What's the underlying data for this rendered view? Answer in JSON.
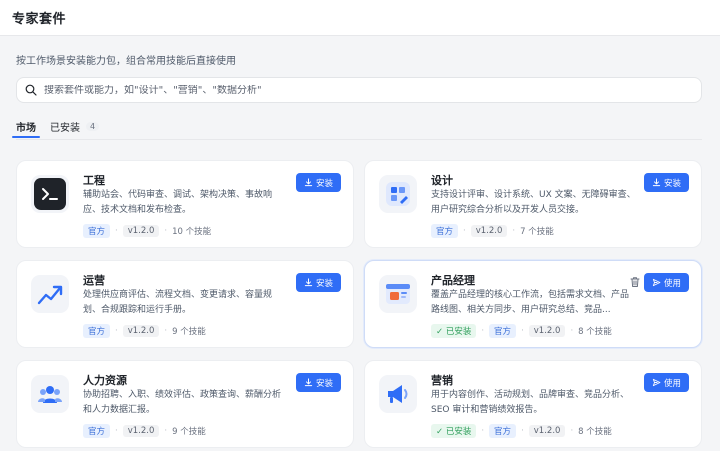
{
  "header": {
    "title": "专家套件"
  },
  "description": "按工作场景安装能力包，组合常用技能后直接使用",
  "search": {
    "placeholder": "搜索套件或能力，如\"设计\"、\"营销\"、\"数据分析\"",
    "value": ""
  },
  "tabs": [
    {
      "label": "市场",
      "active": true
    },
    {
      "label": "已安装",
      "count": "4"
    }
  ],
  "cards": [
    {
      "title": "工程",
      "desc": "辅助站会、代码审查、调试、架构决策、事故响应、技术文档和发布检查。",
      "official": "官方",
      "version": "v1.2.0",
      "skills": "10 个技能",
      "button": "安装",
      "icon": "terminal-icon",
      "color": "#1f2329"
    },
    {
      "title": "设计",
      "desc": "支持设计评审、设计系统、UX 文案、无障碍审查、用户研究综合分析以及开发人员交接。",
      "official": "官方",
      "version": "v1.2.0",
      "skills": "7 个技能",
      "button": "安装",
      "icon": "design-palette-icon",
      "color": "#2f6df6"
    },
    {
      "title": "运营",
      "desc": "处理供应商评估、流程文档、变更请求、容量规划、合规跟踪和运行手册。",
      "official": "官方",
      "version": "v1.2.0",
      "skills": "9 个技能",
      "button": "安装",
      "icon": "trend-chart-icon",
      "color": "#2f6df6"
    },
    {
      "title": "产品经理",
      "desc": "覆盖产品经理的核心工作流，包括需求文档、产品路线图、相关方同步、用户研究总结、竞品...",
      "installed": "已安装",
      "official": "官方",
      "version": "v1.2.0",
      "skills": "8 个技能",
      "button": "使用",
      "icon": "product-window-icon",
      "color": "#f06b3c"
    },
    {
      "title": "人力资源",
      "desc": "协助招聘、入职、绩效评估、政策查询、薪酬分析和人力数据汇报。",
      "official": "官方",
      "version": "v1.2.0",
      "skills": "9 个技能",
      "button": "安装",
      "icon": "people-group-icon",
      "color": "#2f6df6"
    },
    {
      "title": "营销",
      "desc": "用于内容创作、活动规划、品牌审查、竞品分析、SEO 审计和营销绩效报告。",
      "installed": "已安装",
      "official": "官方",
      "version": "v1.2.0",
      "skills": "8 个技能",
      "button": "使用",
      "icon": "megaphone-icon",
      "color": "#2f6df6"
    }
  ]
}
